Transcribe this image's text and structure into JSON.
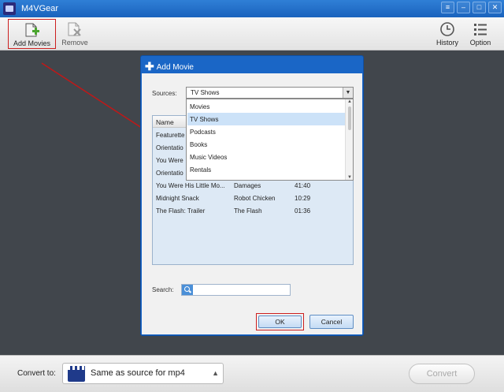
{
  "window": {
    "title": "M4VGear",
    "icons": {
      "app": "m4vgear-logo-icon",
      "menu": "menu-icon",
      "minimize": "minimize-icon",
      "maximize": "maximize-icon",
      "close": "close-icon"
    }
  },
  "toolbar": {
    "add_movies_label": "Add Movies",
    "remove_label": "Remove",
    "history_label": "History",
    "option_label": "Option",
    "icons": {
      "add": "add-movie-icon",
      "remove": "remove-movie-icon",
      "history": "clock-icon",
      "option": "options-list-icon"
    }
  },
  "dialog": {
    "title": "Add Movie",
    "sources_label": "Sources:",
    "sources_value": "TV Shows",
    "sources_options": [
      "Movies",
      "TV Shows",
      "Podcasts",
      "Books",
      "Music Videos",
      "Rentals"
    ],
    "sources_selected_index": 1,
    "list_header": "Name",
    "rows_partial": [
      "Featurette",
      "Orientatio",
      "You Were",
      "Orientatio"
    ],
    "rows": [
      {
        "name": "You Were His Little Mo...",
        "show": "Damages",
        "duration": "41:40"
      },
      {
        "name": "Midnight Snack",
        "show": "Robot Chicken",
        "duration": "10:29"
      },
      {
        "name": "The Flash: Trailer",
        "show": "The Flash",
        "duration": "01:36"
      }
    ],
    "search_label": "Search:",
    "search_value": "",
    "ok_label": "OK",
    "cancel_label": "Cancel"
  },
  "bottom": {
    "convert_to_label": "Convert to:",
    "format_value": "Same as source for mp4",
    "convert_label": "Convert"
  },
  "colors": {
    "accent_blue": "#1a66c6",
    "highlight_red": "#cc1f1f",
    "selected_row": "#cce2f8"
  }
}
